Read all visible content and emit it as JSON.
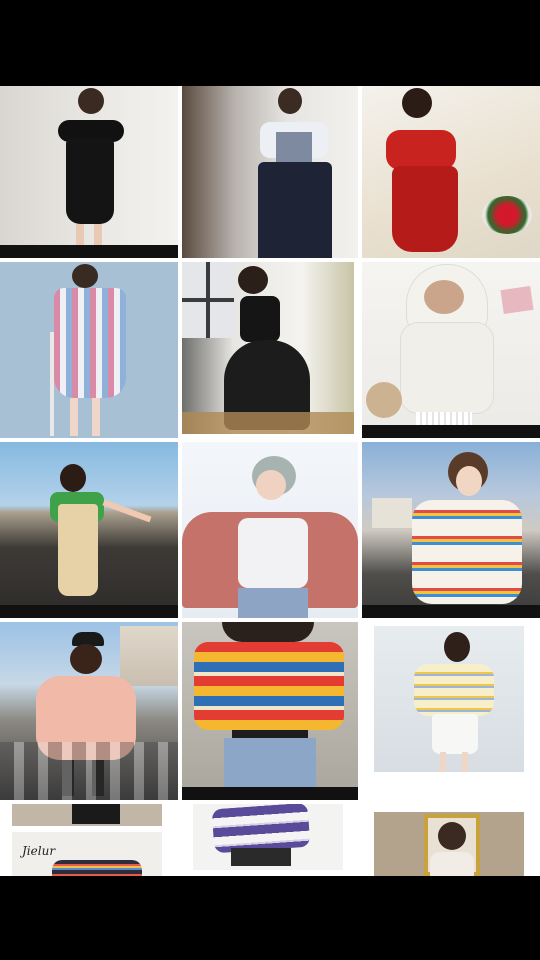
{
  "gallery": {
    "tiles": [
      {
        "name": "tile-black-off-shoulder-dress",
        "caption": ""
      },
      {
        "name": "tile-lace-top-navy-skirt",
        "caption": ""
      },
      {
        "name": "tile-red-ruffle-dress-roses",
        "caption": ""
      },
      {
        "name": "tile-striped-shirt-dress",
        "caption": ""
      },
      {
        "name": "tile-black-lace-tulle-dress",
        "caption": ""
      },
      {
        "name": "tile-white-bear-hoodie",
        "caption": ""
      },
      {
        "name": "tile-green-tee-overalls",
        "caption": ""
      },
      {
        "name": "tile-pink-fur-jacket-snow",
        "caption": ""
      },
      {
        "name": "tile-rainbow-stripe-sweater",
        "caption": ""
      },
      {
        "name": "tile-pink-hoodie-street",
        "caption": ""
      },
      {
        "name": "tile-rainbow-stripe-tee-jeans",
        "caption": ""
      },
      {
        "name": "tile-yellow-stripe-top-white-skirt",
        "caption": ""
      },
      {
        "name": "tile-jielur-stripe-tee",
        "caption": "Jielur"
      },
      {
        "name": "tile-purple-stripe-sweater",
        "caption": ""
      },
      {
        "name": "tile-portrait-frame",
        "caption": ""
      }
    ]
  }
}
